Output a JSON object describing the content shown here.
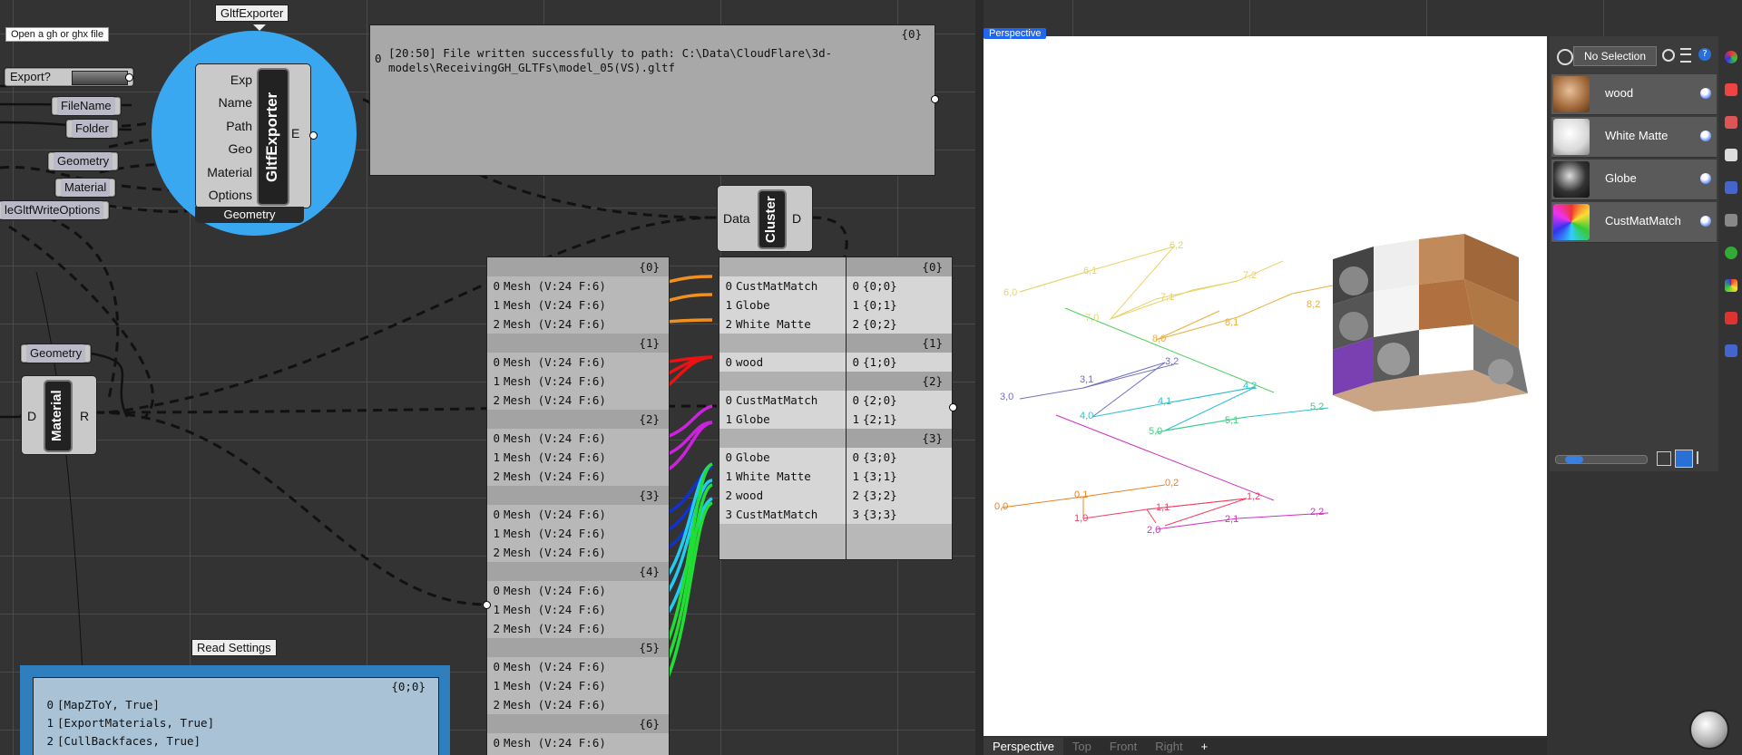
{
  "tooltip": {
    "open_file": "Open a gh or ghx file"
  },
  "gltf_exporter": {
    "tag_label": "GltfExporter",
    "title": "GltfExporter",
    "inputs": [
      "Exp",
      "Name",
      "Path",
      "Geo",
      "Material",
      "Options"
    ],
    "output": "E",
    "footer": "Geometry"
  },
  "params_left": {
    "export_label": "Export?",
    "filename": "FileName",
    "folder": "Folder",
    "geometry": "Geometry",
    "material": "Material",
    "options": "leGltfWriteOptions",
    "geometry2": "Geometry"
  },
  "output_panel": {
    "branch": "{0}",
    "index": "0",
    "text": "[20:50] File written successfully to path: C:\\Data\\CloudFlare\\3d-models\\ReceivingGH_GLTFs\\model_05(VS).gltf"
  },
  "cluster": {
    "title": "Cluster",
    "input": "Data",
    "output": "D"
  },
  "material_comp": {
    "title": "Material",
    "input": "D",
    "output": "R"
  },
  "mesh_panel": {
    "groups": [
      {
        "branch": "{0}",
        "items": [
          "Mesh (V:24  F:6)",
          "Mesh (V:24  F:6)",
          "Mesh (V:24  F:6)"
        ]
      },
      {
        "branch": "{1}",
        "items": [
          "Mesh (V:24  F:6)",
          "Mesh (V:24  F:6)",
          "Mesh (V:24  F:6)"
        ]
      },
      {
        "branch": "{2}",
        "items": [
          "Mesh (V:24  F:6)",
          "Mesh (V:24  F:6)",
          "Mesh (V:24  F:6)"
        ]
      },
      {
        "branch": "{3}",
        "items": [
          "Mesh (V:24  F:6)",
          "Mesh (V:24  F:6)",
          "Mesh (V:24  F:6)"
        ]
      },
      {
        "branch": "{4}",
        "items": [
          "Mesh (V:24  F:6)",
          "Mesh (V:24  F:6)",
          "Mesh (V:24  F:6)"
        ]
      },
      {
        "branch": "{5}",
        "items": [
          "Mesh (V:24  F:6)",
          "Mesh (V:24  F:6)",
          "Mesh (V:24  F:6)"
        ]
      },
      {
        "branch": "{6}",
        "items": [
          "Mesh (V:24  F:6)"
        ]
      }
    ]
  },
  "names_panel": {
    "groups": [
      {
        "items": [
          "CustMatMatch",
          "Globe",
          "White Matte"
        ]
      },
      {
        "items": [
          "wood"
        ]
      },
      {
        "items": [
          "CustMatMatch",
          "Globe"
        ]
      },
      {
        "items": [
          "Globe",
          "White Matte",
          "wood",
          "CustMatMatch"
        ]
      }
    ]
  },
  "paths_panel": {
    "groups": [
      {
        "branch": "{0}",
        "items": [
          "{0;0}",
          "{0;1}",
          "{0;2}"
        ]
      },
      {
        "branch": "{1}",
        "items": [
          "{1;0}"
        ]
      },
      {
        "branch": "{2}",
        "items": [
          "{2;0}",
          "{2;1}"
        ]
      },
      {
        "branch": "{3}",
        "items": [
          "{3;0}",
          "{3;1}",
          "{3;2}",
          "{3;3}"
        ]
      }
    ]
  },
  "read_settings": {
    "tag_label": "Read Settings",
    "branch": "{0;0}",
    "items": [
      "[MapZToY, True]",
      "[ExportMaterials, True]",
      "[CullBackfaces, True]"
    ]
  },
  "viewport": {
    "tab_label": "Perspective",
    "tabs": [
      "Perspective",
      "Top",
      "Front",
      "Right",
      "+"
    ],
    "tree_labels": [
      {
        "t": "6,0",
        "c": "#e8d36a"
      },
      {
        "t": "6,1",
        "c": "#e8d36a"
      },
      {
        "t": "6,2",
        "c": "#e8d36a"
      },
      {
        "t": "7,0",
        "c": "#e8d36a"
      },
      {
        "t": "7,1",
        "c": "#e8d36a"
      },
      {
        "t": "7,2",
        "c": "#e8d36a"
      },
      {
        "t": "8,0",
        "c": "#e8b040"
      },
      {
        "t": "8,1",
        "c": "#e8b040"
      },
      {
        "t": "8,2",
        "c": "#e8b040"
      },
      {
        "t": "3,0",
        "c": "#7070c0"
      },
      {
        "t": "3,1",
        "c": "#7070c0"
      },
      {
        "t": "3,2",
        "c": "#7070c0"
      },
      {
        "t": "4,0",
        "c": "#30c0d0"
      },
      {
        "t": "4,1",
        "c": "#30c0d0"
      },
      {
        "t": "4,2",
        "c": "#30c0d0"
      },
      {
        "t": "5,0",
        "c": "#40d080"
      },
      {
        "t": "5,1",
        "c": "#40d080"
      },
      {
        "t": "5,2",
        "c": "#40d080"
      },
      {
        "t": "0,0",
        "c": "#f08020"
      },
      {
        "t": "0,1",
        "c": "#f08020"
      },
      {
        "t": "0,2",
        "c": "#f08020"
      },
      {
        "t": "1,0",
        "c": "#f04060"
      },
      {
        "t": "1,1",
        "c": "#f04060"
      },
      {
        "t": "1,2",
        "c": "#f04060"
      },
      {
        "t": "2,0",
        "c": "#d030c0"
      },
      {
        "t": "2,1",
        "c": "#d030c0"
      },
      {
        "t": "2,2",
        "c": "#d030c0"
      }
    ]
  },
  "materials_panel": {
    "selection_label": "No Selection",
    "materials": [
      {
        "name": "wood",
        "icon": "wood-sphere"
      },
      {
        "name": "White Matte",
        "icon": "white-sphere"
      },
      {
        "name": "Globe",
        "icon": "globe-sphere"
      },
      {
        "name": "CustMatMatch",
        "icon": "custom-sphere"
      }
    ]
  }
}
